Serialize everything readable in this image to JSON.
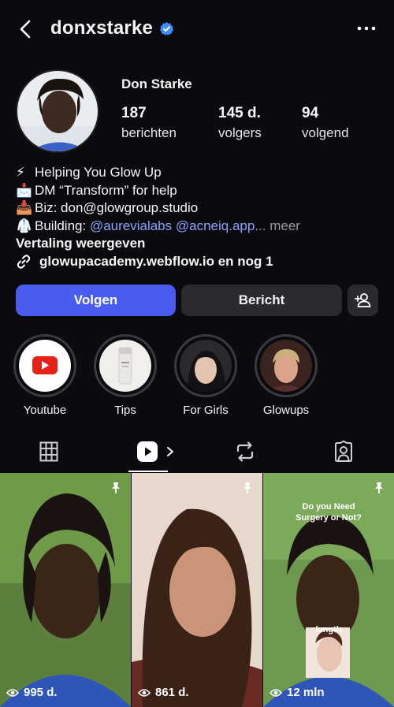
{
  "header": {
    "username": "donxstarke",
    "back_icon": "chevron-left-icon",
    "verified_icon": "verified-badge-icon",
    "more_icon": "more-horizontal-icon"
  },
  "profile": {
    "display_name": "Don Starke",
    "stats": [
      {
        "value": "187",
        "label": "berichten"
      },
      {
        "value": "145 d.",
        "label": "volgers"
      },
      {
        "value": "94",
        "label": "volgend"
      }
    ]
  },
  "bio": {
    "lines": [
      {
        "emoji": "⚡",
        "text": "Helping You Glow Up"
      },
      {
        "emoji": "📩",
        "text": "DM “Transform” for help"
      },
      {
        "emoji": "📥",
        "text": "Biz: don@glowgroup.studio"
      },
      {
        "emoji": "🥼",
        "text": "Building: ",
        "mention1": "@aurevialabs",
        "mention2": "@acneiq.app",
        "ellipsis": "...",
        "more": " meer"
      }
    ],
    "translate": "Vertaling weergeven",
    "link": "glowupacademy.webflow.io en nog 1"
  },
  "buttons": {
    "follow": "Volgen",
    "message": "Bericht",
    "add_user_icon": "person-add-icon"
  },
  "highlights": [
    {
      "label": "Youtube"
    },
    {
      "label": "Tips"
    },
    {
      "label": "For Girls"
    },
    {
      "label": "Glowups"
    }
  ],
  "tabs": [
    "grid-icon",
    "reels-icon",
    "reposts-icon",
    "tagged-icon"
  ],
  "reels": [
    {
      "views": "995 d.",
      "pinned": true
    },
    {
      "views": "861 d.",
      "pinned": true
    },
    {
      "views": "12 mln",
      "pinned": true,
      "overlay_title": "Do you Need Surgery or Not?",
      "overlay_label": "length"
    }
  ],
  "colors": {
    "background": "#0b0b0f",
    "follow_button": "#4a5cf0",
    "secondary_button": "#2a2b30",
    "mention": "#8aa4ff",
    "verified": "#3e8bff"
  }
}
